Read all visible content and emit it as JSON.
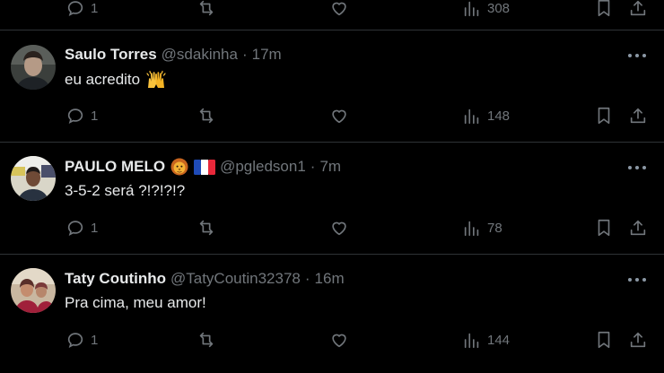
{
  "top_partial": {
    "reply_count": "1",
    "views_count": "308"
  },
  "posts": [
    {
      "name": "Saulo Torres",
      "handle": "@sdakinha",
      "separator": "·",
      "time": "17m",
      "text": "eu acredito",
      "text_emoji": "raising-hands-icon",
      "replies": "1",
      "views": "148"
    },
    {
      "name": "PAULO MELO",
      "name_emojis": [
        "lion-face-icon",
        "france-flag-icon"
      ],
      "handle": "@pgledson1",
      "separator": "·",
      "time": "7m",
      "text": "3-5-2 será ?!?!?!?",
      "replies": "1",
      "views": "78"
    },
    {
      "name": "Taty Coutinho",
      "handle": "@TatyCoutin32378",
      "separator": "·",
      "time": "16m",
      "text": "Pra cima, meu amor!",
      "replies": "1",
      "views": "144"
    }
  ],
  "colors": {
    "background": "#000000",
    "primary_text": "#e7e9ea",
    "secondary_text": "#71767b",
    "divider": "#2f3336"
  }
}
